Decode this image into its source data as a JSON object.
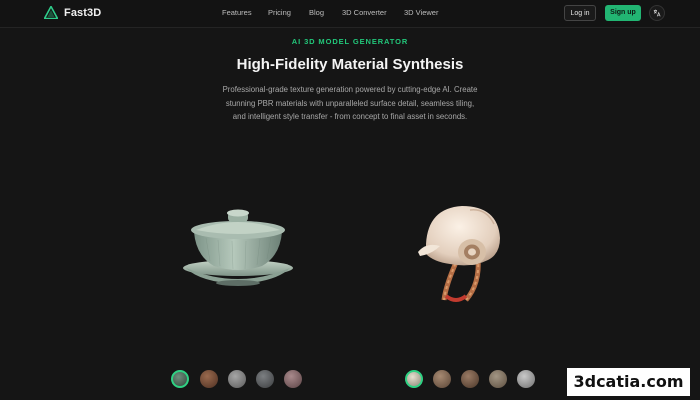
{
  "nav": {
    "brand": "Fast3D",
    "links": [
      "Features",
      "Pricing",
      "Blog",
      "3D Converter",
      "3D Viewer"
    ],
    "login": "Log in",
    "signup": "Sign up",
    "lang_icon": "translate-icon"
  },
  "hero": {
    "eyebrow": "AI 3D MODEL GENERATOR",
    "title": "High-Fidelity Material Synthesis",
    "description_lines": [
      "Professional-grade texture generation powered by cutting-edge AI. Create",
      "stunning PBR materials with unparalleled surface detail, seamless tiling,",
      "and intelligent style transfer - from concept to final asset in seconds."
    ]
  },
  "models": {
    "left": {
      "name": "tea-set",
      "swatches": [
        "celadon",
        "wood",
        "stone",
        "dark-stone",
        "pink-marble"
      ],
      "selected": 0
    },
    "right": {
      "name": "helmet",
      "swatches": [
        "cream",
        "brown-stone",
        "brown-marble",
        "tan-stone",
        "grey"
      ],
      "selected": 0
    }
  },
  "colors": {
    "accent": "#22b573",
    "background": "#151515"
  },
  "watermark": "3dcatia.com"
}
